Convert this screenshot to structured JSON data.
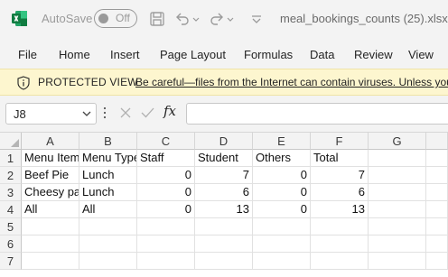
{
  "titlebar": {
    "autosave_label": "AutoSave",
    "autosave_state": "Off",
    "filename": "meal_bookings_counts (25).xlsx  •",
    "icons": [
      "excel-logo-icon",
      "save-icon",
      "undo-icon",
      "redo-icon"
    ]
  },
  "ribbon": {
    "tabs": [
      "File",
      "Home",
      "Insert",
      "Page Layout",
      "Formulas",
      "Data",
      "Review",
      "View"
    ]
  },
  "protected_view": {
    "title": "PROTECTED VIEW",
    "message": "Be careful—files from the Internet can contain viruses. Unless you need to edit, it's safer to stay in Protected View."
  },
  "formula_bar": {
    "name_box": "J8",
    "fx_label": "fx",
    "formula": ""
  },
  "sheet": {
    "columns": [
      "A",
      "B",
      "C",
      "D",
      "E",
      "F",
      "G"
    ],
    "row_numbers": [
      "1",
      "2",
      "3",
      "4",
      "5",
      "6",
      "7"
    ],
    "rows": [
      [
        "Menu Item",
        "Menu Type",
        "Staff",
        "Student",
        "Others",
        "Total",
        ""
      ],
      [
        "Beef Pie",
        "Lunch",
        "0",
        "7",
        "0",
        "7",
        ""
      ],
      [
        "Cheesy pasta",
        "Lunch",
        "0",
        "6",
        "0",
        "6",
        ""
      ],
      [
        "All",
        "All",
        "0",
        "13",
        "0",
        "13",
        ""
      ],
      [
        "",
        "",
        "",
        "",
        "",
        "",
        ""
      ],
      [
        "",
        "",
        "",
        "",
        "",
        "",
        ""
      ],
      [
        "",
        "",
        "",
        "",
        "",
        "",
        ""
      ]
    ]
  },
  "colors": {
    "excel_green": "#107c41",
    "protected_bg": "#fdf6cf",
    "chrome_bg": "#f3f3f3"
  }
}
